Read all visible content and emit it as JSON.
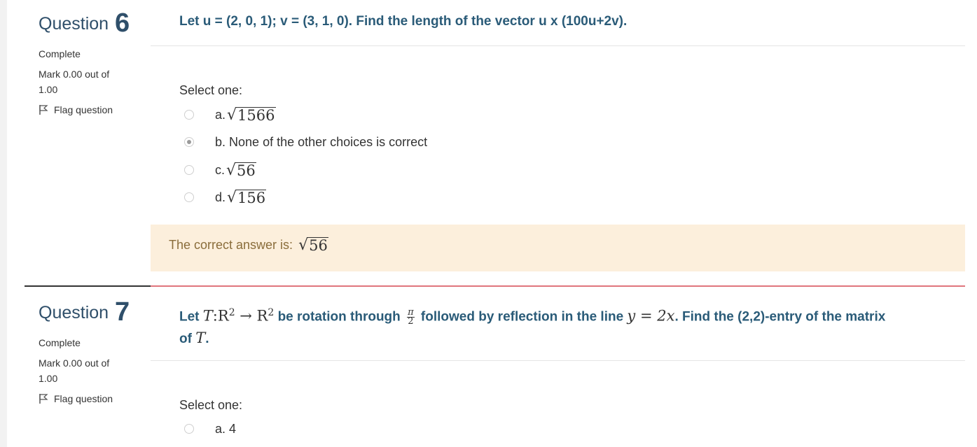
{
  "q6": {
    "label": "Question",
    "number": "6",
    "state": "Complete",
    "grade": "Mark 0.00 out of 1.00",
    "flag": "Flag question",
    "prompt": "Let u = (2, 0, 1); v = (3, 1, 0). Find the length of the vector u x (100u+2v).",
    "select_one": "Select one:",
    "options": [
      {
        "prefix": "a.",
        "radicand": "1566",
        "selected": false
      },
      {
        "prefix": "b.",
        "text": "None of the other choices is correct",
        "selected": true
      },
      {
        "prefix": "c.",
        "radicand": "56",
        "selected": false
      },
      {
        "prefix": "d.",
        "radicand": "156",
        "selected": false
      }
    ],
    "feedback_prefix": "The correct answer is:",
    "feedback_radicand": "56"
  },
  "q7": {
    "label": "Question",
    "number": "7",
    "state": "Complete",
    "grade": "Mark 0.00 out of 1.00",
    "flag": "Flag question",
    "prompt_parts": {
      "let": "Let",
      "T": "T",
      "colon_r": ":R",
      "sup1": "2",
      "arrow": " → R",
      "sup2": "2",
      "be_rot": "be rotation through",
      "pi": "π",
      "two": "2",
      "followed": "followed by reflection in the line",
      "eq": "y = 2x",
      "find": ". Find the (2,2)-entry of the matrix",
      "of": "of",
      "T2": "T",
      "end": "."
    },
    "select_one": "Select one:",
    "options": [
      {
        "prefix": "a.",
        "text": "4",
        "selected": false
      }
    ]
  }
}
